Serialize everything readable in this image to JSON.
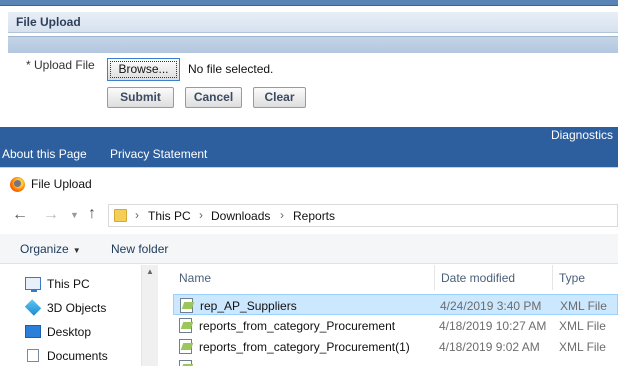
{
  "page": {
    "section_title": "File Upload",
    "upload_label": "* Upload File",
    "browse_label": "Browse...",
    "no_file_text": "No file selected.",
    "buttons": {
      "submit": "Submit",
      "cancel": "Cancel",
      "clear": "Clear"
    },
    "footer": {
      "diagnostics": "Diagnostics",
      "about": "About this Page",
      "privacy": "Privacy Statement"
    }
  },
  "dialog": {
    "title": "File Upload",
    "icon": "firefox-icon",
    "breadcrumb": [
      "This PC",
      "Downloads",
      "Reports"
    ],
    "toolbar": {
      "organize": "Organize",
      "new_folder": "New folder"
    },
    "nav_items": [
      {
        "label": "This PC",
        "icon": "computer-icon"
      },
      {
        "label": "3D Objects",
        "icon": "3d-objects-icon"
      },
      {
        "label": "Desktop",
        "icon": "desktop-icon"
      },
      {
        "label": "Documents",
        "icon": "documents-icon"
      }
    ],
    "columns": {
      "name": "Name",
      "date": "Date modified",
      "type": "Type"
    },
    "files": [
      {
        "name": "rep_AP_Suppliers",
        "date": "4/24/2019 3:40 PM",
        "type": "XML File",
        "selected": true
      },
      {
        "name": "reports_from_category_Procurement",
        "date": "4/18/2019 10:27 AM",
        "type": "XML File",
        "selected": false
      },
      {
        "name": "reports_from_category_Procurement(1)",
        "date": "4/18/2019 9:02 AM",
        "type": "XML File",
        "selected": false
      }
    ]
  },
  "colors": {
    "header_blue": "#2d5e9e",
    "selection": "#cce8ff"
  }
}
